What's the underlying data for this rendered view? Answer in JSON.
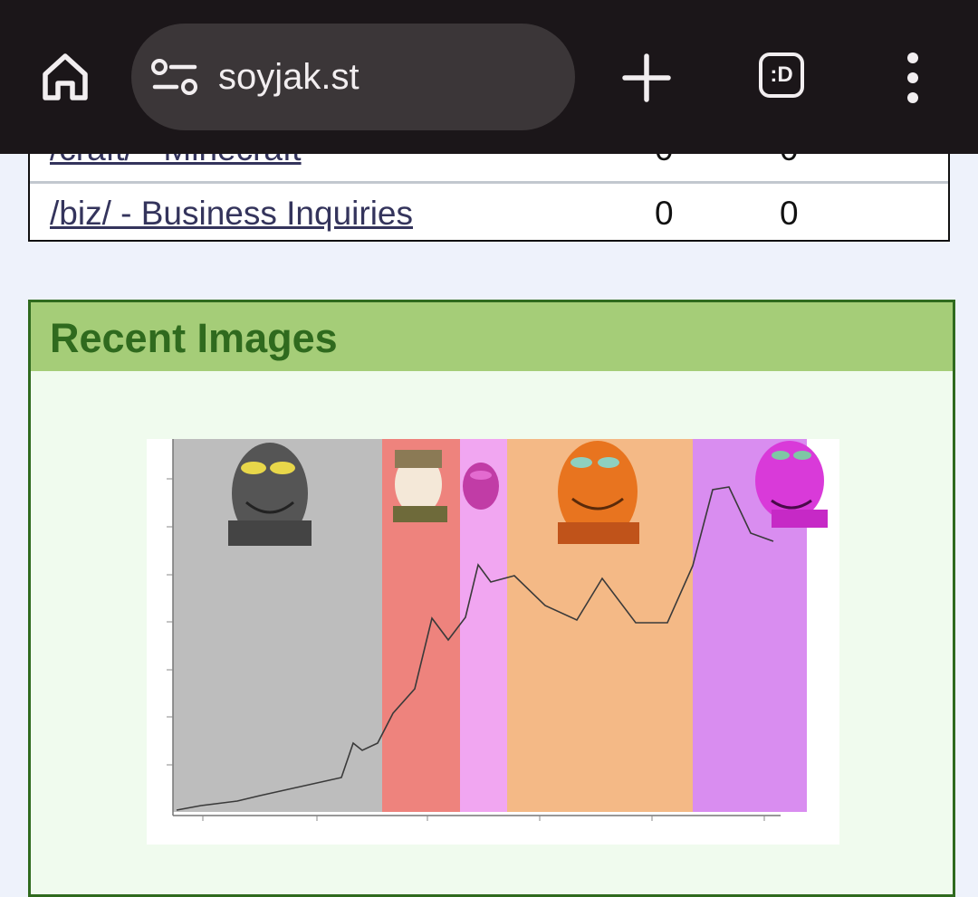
{
  "browser": {
    "url": "soyjak.st",
    "tabs_count_label": ":D",
    "icons": [
      "home-icon",
      "site-info-icon",
      "new-tab-icon",
      "tab-switcher-icon",
      "overflow-menu-icon"
    ]
  },
  "boards": {
    "rows": [
      {
        "name": "/craft/ - Minecraft",
        "posts": "0",
        "pph": "0"
      },
      {
        "name": "/biz/ - Business Inquiries",
        "posts": "0",
        "pph": "0"
      }
    ]
  },
  "recent_images": {
    "title": "Recent Images",
    "thumbnail": {
      "description_icon": "soyjak-era-graph-image",
      "bands": [
        {
          "color": "#bdbdbd"
        },
        {
          "color": "#ee837d"
        },
        {
          "color": "#f1a6f1"
        },
        {
          "color": "#f4b986"
        },
        {
          "color": "#d98df0"
        }
      ],
      "line_color": "#3a3a3a"
    }
  },
  "colors": {
    "toolbar": "#1b1619",
    "urlbar": "#3b3638",
    "page_bg": "#eef2fb",
    "link": "#34345c",
    "box_border": "#2f6a1e",
    "box_header": "#a5cd78",
    "box_bg": "#f0fbee"
  }
}
